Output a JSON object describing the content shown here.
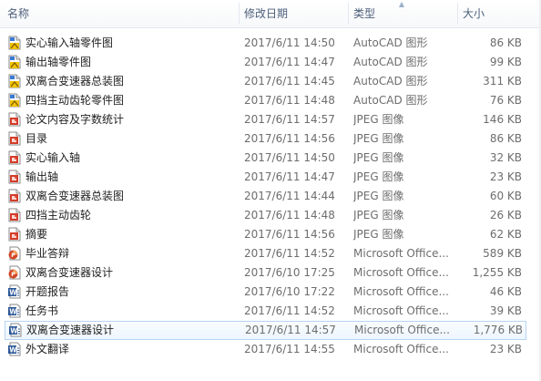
{
  "columns": {
    "name": "名称",
    "date": "修改日期",
    "type": "类型",
    "size": "大小"
  },
  "files": [
    {
      "name": "实心输入轴零件图",
      "date": "2017/6/11 14:50",
      "type": "AutoCAD 图形",
      "size": "86 KB",
      "icon": "autocad-drawing-icon"
    },
    {
      "name": "输出轴零件图",
      "date": "2017/6/11 14:47",
      "type": "AutoCAD 图形",
      "size": "99 KB",
      "icon": "autocad-drawing-icon"
    },
    {
      "name": "双离合变速器总装图",
      "date": "2017/6/11 14:45",
      "type": "AutoCAD 图形",
      "size": "311 KB",
      "icon": "autocad-drawing-icon"
    },
    {
      "name": "四挡主动齿轮零件图",
      "date": "2017/6/11 14:48",
      "type": "AutoCAD 图形",
      "size": "76 KB",
      "icon": "autocad-drawing-icon"
    },
    {
      "name": "论文内容及字数统计",
      "date": "2017/6/11 14:57",
      "type": "JPEG 图像",
      "size": "146 KB",
      "icon": "jpeg-image-icon"
    },
    {
      "name": "目录",
      "date": "2017/6/11 14:56",
      "type": "JPEG 图像",
      "size": "86 KB",
      "icon": "jpeg-image-icon"
    },
    {
      "name": "实心输入轴",
      "date": "2017/6/11 14:50",
      "type": "JPEG 图像",
      "size": "32 KB",
      "icon": "jpeg-image-icon"
    },
    {
      "name": "输出轴",
      "date": "2017/6/11 14:47",
      "type": "JPEG 图像",
      "size": "23 KB",
      "icon": "jpeg-image-icon"
    },
    {
      "name": "双离合变速器总装图",
      "date": "2017/6/11 14:44",
      "type": "JPEG 图像",
      "size": "60 KB",
      "icon": "jpeg-image-icon"
    },
    {
      "name": "四挡主动齿轮",
      "date": "2017/6/11 14:48",
      "type": "JPEG 图像",
      "size": "26 KB",
      "icon": "jpeg-image-icon"
    },
    {
      "name": "摘要",
      "date": "2017/6/11 14:56",
      "type": "JPEG 图像",
      "size": "62 KB",
      "icon": "jpeg-image-icon"
    },
    {
      "name": "毕业答辩",
      "date": "2017/6/11 14:52",
      "type": "Microsoft Office...",
      "size": "589 KB",
      "icon": "powerpoint-document-icon"
    },
    {
      "name": "双离合变速器设计",
      "date": "2017/6/10 17:25",
      "type": "Microsoft Office...",
      "size": "1,255 KB",
      "icon": "powerpoint-document-icon"
    },
    {
      "name": "开题报告",
      "date": "2017/6/10 17:22",
      "type": "Microsoft Office...",
      "size": "46 KB",
      "icon": "word-document-icon"
    },
    {
      "name": "任务书",
      "date": "2017/6/11 14:52",
      "type": "Microsoft Office...",
      "size": "39 KB",
      "icon": "word-document-icon"
    },
    {
      "name": "双离合变速器设计",
      "date": "2017/6/11 14:57",
      "type": "Microsoft Office...",
      "size": "1,776 KB",
      "icon": "word-document-icon",
      "selected": true
    },
    {
      "name": "外文翻译",
      "date": "2017/6/11 14:55",
      "type": "Microsoft Office...",
      "size": "23 KB",
      "icon": "word-document-icon"
    }
  ],
  "colors": {
    "selection_border": "#b7d4f2",
    "selection_fill": "#edf5fe",
    "header_text": "#4c607a",
    "autocad_accent": "#f2c200",
    "jpeg_accent": "#d43c2a",
    "powerpoint_accent": "#d24726",
    "word_accent": "#2b5797"
  }
}
